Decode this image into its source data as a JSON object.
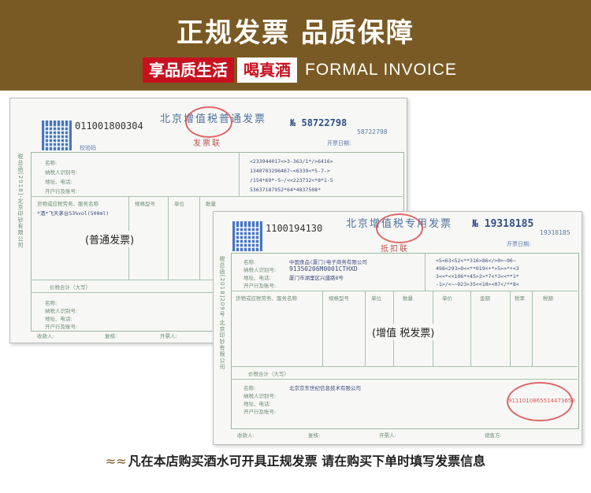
{
  "banner": {
    "title": "正规发票 品质保障",
    "tag_red": "享品质生活",
    "tag_white": "喝真酒",
    "tag_en": "FORMAL INVOICE"
  },
  "invoice_general": {
    "code": "011001800304",
    "title": "北京增值税普通发票",
    "no_prefix": "№",
    "no": "58722798",
    "no_small": "58722798",
    "stamp_text": "发票联",
    "date_label": "开票日期:",
    "check_code": "校验码",
    "row_labels": [
      "名称:",
      "纳税人识别号:",
      "地址、电话:",
      "开户行及账号:"
    ],
    "cipher_lines": [
      "<233944017<>3-363/1*/>6416>",
      "1340703296467~<6339<*5-7->",
      "/154*69*-5~/<<223732<*8*1-5",
      "53637187952*64*4837508*"
    ],
    "goods_header": [
      "货物或应税劳务、服务名称",
      "规格型号",
      "单位",
      "数量"
    ],
    "goods_line": "*酒*飞天茅台53%vol(500ml)",
    "total_label": "价税合计（大写）",
    "seller_labels": [
      "名称:",
      "纳税人识别号:",
      "地址、电话:",
      "开户行及账号:"
    ],
    "bottom_labels": [
      "收款人:",
      "复核:",
      "开票人:"
    ],
    "side_label": "税总函[2018]·北京印钞有限公司",
    "overlay": "(普通发票)"
  },
  "invoice_special": {
    "code": "1100194130",
    "title": "北京增值税专用发票",
    "no_prefix": "№",
    "no": "19318185",
    "no_small": "19318185",
    "stamp_text": "抵扣联",
    "date_label": "开票日期:",
    "buyer_name": "中国食品(厦门)电子商务有限公司",
    "buyer_tax": "91350206M0001CTHXD",
    "buyer_addr": "厦门市湖里区兴盛路8号",
    "row_labels": [
      "名称:",
      "纳税人识别号:",
      "地址、电话:",
      "开户行及账号:"
    ],
    "cipher_lines": [
      "<5<63<52<**316>86</>0>~96~",
      "498<293>0<<**019<+*>5>>*+<3",
      "3<<*<<106*+45>2>*7<*3<<**1*",
      "-1>/<~~923>35<<10><07</**8<"
    ],
    "goods_header": [
      "货物或应税劳务、服务名称",
      "规格型号",
      "单位",
      "数量",
      "单价",
      "金额",
      "税率",
      "税额"
    ],
    "total_label": "价税合计（大写）",
    "seller_name": "北京京东世纪信息技术有限公司",
    "seller_labels": [
      "名称:",
      "纳税人识别号:",
      "地址、电话:",
      "开户行及账号:"
    ],
    "bottom_labels": [
      "收款人:",
      "复核:",
      "开票人:",
      "销售方:"
    ],
    "side_label": "税总函[2018]209号·北京印钞有限公司",
    "seal_text": "9111010865514473658",
    "overlay": "(增值 税发票)"
  },
  "footer": {
    "waves": "≈≈",
    "text": "凡在本店购买酒水可开具正规发票  请在购买下单时填写发票信息",
    "waves_right": "≈≈"
  },
  "colors": {
    "banner_bg": "#7a5a24",
    "tag_red": "#c8111f",
    "stamp_red": "#d63838",
    "invoice_blue": "#4d6f9e",
    "grid_green": "#9fb6a2"
  }
}
